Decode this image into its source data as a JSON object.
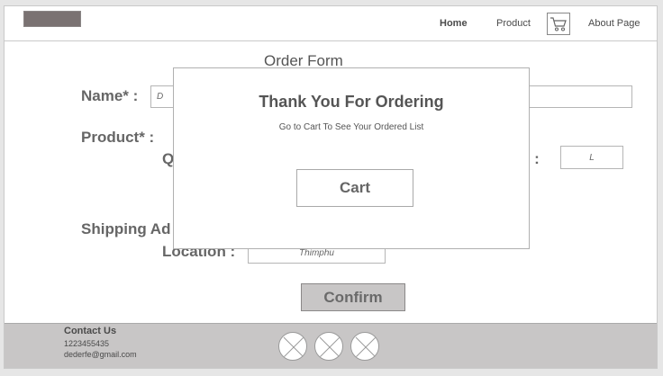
{
  "header": {
    "nav": [
      {
        "label": "Home"
      },
      {
        "label": "Product"
      },
      {
        "label": "About Page"
      }
    ],
    "cart_icon": "cart-icon"
  },
  "form": {
    "title": "Order Form",
    "name_label": "Name* :",
    "name_value": "D",
    "product_label": "Product* :",
    "quantity_label_fragment": "Q",
    "size_label_fragment": "e :",
    "size_value": "L",
    "shipping_label_fragment": "Shipping Ad",
    "location_label": "Location :",
    "location_value": "Thimphu",
    "confirm_label": "Confirm"
  },
  "modal": {
    "title": "Thank You For Ordering",
    "subtitle": "Go to Cart To See Your Ordered List",
    "cart_button": "Cart"
  },
  "footer": {
    "contact_title": "Contact Us",
    "phone": "1223455435",
    "email": "dederfe@gmail.com",
    "social_icons": [
      "placeholder-icon",
      "placeholder-icon",
      "placeholder-icon"
    ]
  }
}
